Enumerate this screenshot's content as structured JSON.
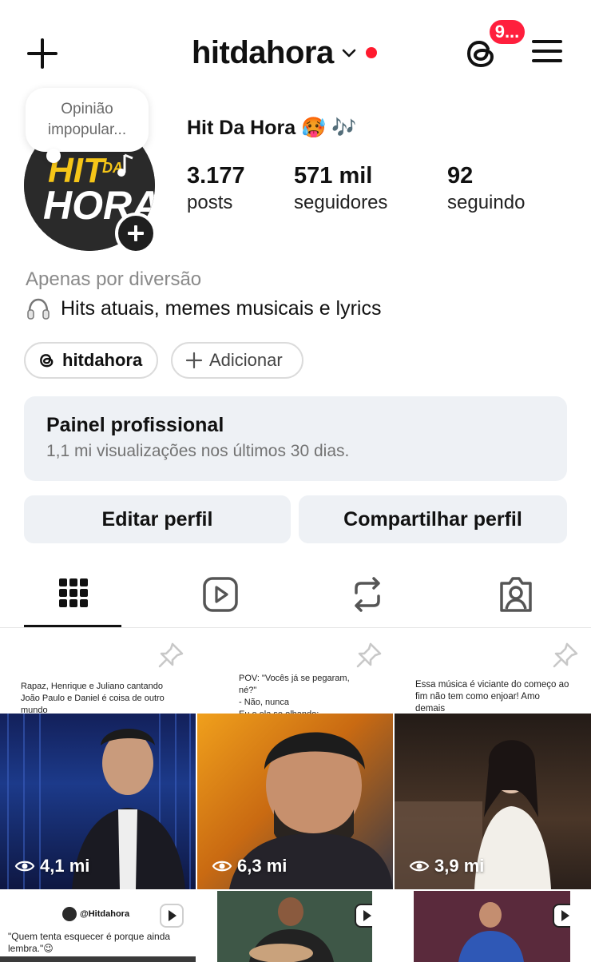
{
  "header": {
    "username": "hitdahora",
    "notification_badge": "9...",
    "icons": [
      "plus-icon",
      "chevron-down-icon",
      "threads-icon",
      "hamburger-menu-icon"
    ],
    "status_dot_color": "#ff1a2e"
  },
  "profile": {
    "note": [
      "Opinião",
      "impopular..."
    ],
    "avatar_text": "HIT DA HORA",
    "display_name": "Hit Da Hora 🥵 🎶",
    "stats": [
      {
        "value": "3.177",
        "label": "posts"
      },
      {
        "value": "571 mil",
        "label": "seguidores"
      },
      {
        "value": "92",
        "label": "seguindo"
      }
    ],
    "category": "Apenas por diversão",
    "bio": "Hits atuais, memes musicais e lyrics",
    "links": {
      "threads": "hitdahora",
      "add": "Adicionar"
    }
  },
  "panel": {
    "title": "Painel profissional",
    "subtitle": "1,1 mi visualizações nos últimos 30 dias."
  },
  "actions": {
    "edit": "Editar perfil",
    "share": "Compartilhar perfil"
  },
  "tabs": [
    "grid-icon",
    "reels-icon",
    "reposts-icon",
    "tagged-icon"
  ],
  "posts": [
    {
      "caption": "Rapaz, Henrique e Juliano cantando João Paulo e Daniel é coisa de outro mundo",
      "views": "4,1 mi",
      "pinned": true
    },
    {
      "caption_lines": [
        "POV: \"Vocês já se pegaram, né?\"",
        "- Não, nunca",
        "Eu e ela se olhando:"
      ],
      "views": "6,3 mi",
      "pinned": true
    },
    {
      "caption": "Essa música é viciante do começo ao fim não tem como enjoar! Amo demais",
      "views": "3,9 mi",
      "pinned": true
    },
    {
      "handle": "@Hitdahora",
      "caption": "\"Quem tenta esquecer é porque ainda lembra.\"😉"
    },
    {
      "caption": ""
    },
    {
      "caption": ""
    }
  ]
}
